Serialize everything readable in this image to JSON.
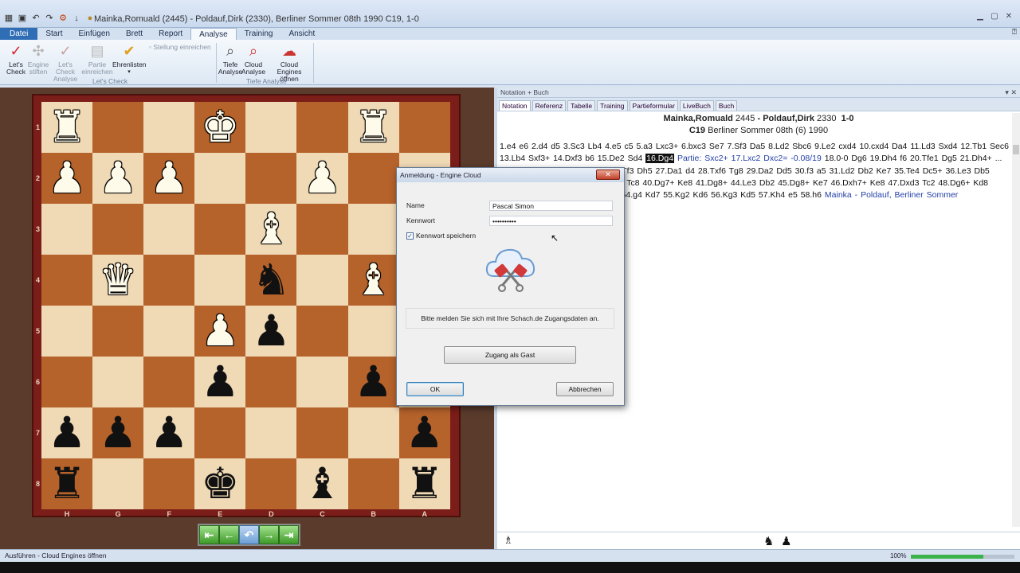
{
  "window": {
    "title": "Mainka,Romuald (2445) - Poldauf,Dirk (2330), Berliner Sommer 08th 1990  C19, 1-0"
  },
  "ribbon": {
    "tabs": [
      "Datei",
      "Start",
      "Einfügen",
      "Brett",
      "Report",
      "Analyse",
      "Training",
      "Ansicht"
    ],
    "active_tab": "Analyse",
    "buttons": {
      "lets_check": "Let's Check",
      "engine_stiften": "Engine stiften",
      "lets_check_analyse": "Let's Check Analyse",
      "partie_einreichen": "Partie einreichen",
      "ehrenlisten": "Ehrenlisten",
      "stellung_einreichen": "Stellung einreichen",
      "tiefe_analyse": "Tiefe Analyse",
      "cloud_analyse": "Cloud Analyse",
      "cloud_engines_oeffnen": "Cloud Engines öffnen"
    },
    "groups": {
      "lets_check": "Let's Check",
      "tiefe_analyse": "Tiefe Analyse"
    }
  },
  "board": {
    "ranks": [
      "1",
      "2",
      "3",
      "4",
      "5",
      "6",
      "7",
      "8"
    ],
    "files": [
      "H",
      "G",
      "F",
      "E",
      "D",
      "C",
      "B",
      "A"
    ],
    "pieces": [
      [
        "♜w",
        "",
        "",
        "♚w",
        "",
        "",
        "♜w",
        ""
      ],
      [
        "♟w",
        "♟w",
        "♟w",
        "",
        "",
        "♟w",
        "",
        ""
      ],
      [
        "",
        "",
        "",
        "",
        "♝w",
        "",
        "",
        ""
      ],
      [
        "",
        "♛w",
        "",
        "",
        "♞b",
        "",
        "♝w",
        ""
      ],
      [
        "",
        "",
        "",
        "♟w",
        "♟b",
        "",
        "",
        ""
      ],
      [
        "",
        "",
        "",
        "♟b",
        "",
        "",
        "♟b",
        ""
      ],
      [
        "♟b",
        "♟b",
        "♟b",
        "",
        "",
        "",
        "",
        "♟b"
      ],
      [
        "♜b",
        "",
        "",
        "♚b",
        "",
        "♝b",
        "",
        "♜b"
      ]
    ]
  },
  "notation": {
    "pane_title": "Notation + Buch",
    "tabs": [
      "Notation",
      "Referenz",
      "Tabelle",
      "Training",
      "Partieformular",
      "LiveBuch",
      "Buch"
    ],
    "active_tab": "Notation",
    "header_line1_white": "Mainka,Romuald",
    "header_line1_white_elo": "2445",
    "header_line1_black": "Poldauf,Dirk",
    "header_line1_black_elo": "2330",
    "header_line1_result": "1-0",
    "header_line2_eco": "C19",
    "header_line2_event": "Berliner Sommer 08th (6) 1990",
    "moves_before": "1.e4  e6  2.d4  d5  3.Sc3  Lb4  4.e5  c5  5.a3  Lxc3+  6.bxc3  Se7  7.Sf3  Da5  8.Ld2  Sbc6  9.Le2  cxd4  10.cxd4  Da4  11.Ld3  Sxd4  12.Tb1  Sec6  13.Lb4  Sxf3+  14.Dxf3  b6  15.De2  Sd4",
    "current_move": "16.Dg4",
    "variation": "Partie: Sxc2+  17.Lxc2  Dxc2=",
    "eval": "-0.08/19",
    "moves_after": "18.0-0  Dg6  19.Dh4  f6  20.Tfe1  Dg5  21.Dh4+ ... Tc4  24.Dd1  gxf6  25.Tg3  Df5  26.Tf3  Dh5  27.Da1  d4  28.Txf6  Tg8  29.Da2  Dd5  30.f3  a5  31.Ld2  Db2  Ke7  35.Te4  Dc5+  36.Le3  Db5  37.Dc1  c3  38.Dxc3  Db1+  39.Lc1  Tc8  40.Dg7+  Ke8  41.Dg8+  44.Le3  Db2  45.Dg8+  Ke7  46.Dxh7+  Ke8  47.Dxd3  Tc2  48.Dg6+  Kd8  49.h4  Kc8  50.h5  Dc3  Lxc1  Le8  54.g4  Kd7  55.Kg2  Kd6  56.Kg3  Kd5  57.Kh4  e5  58.h6",
    "footer_link": "Mainka - Poldauf, Berliner Sommer"
  },
  "dialog": {
    "title": "Anmeldung - Engine Cloud",
    "name_label": "Name",
    "name_value": "Pascal Simon",
    "password_label": "Kennwort",
    "password_value": "••••••••••",
    "remember_label": "Kennwort speichern",
    "remember_checked": true,
    "message": "Bitte melden Sie sich mit Ihre Schach.de Zugangsdaten an.",
    "guest_button": "Zugang als Gast",
    "ok_button": "OK",
    "cancel_button": "Abbrechen"
  },
  "status": {
    "text": "Ausführen - Cloud Engines öffnen",
    "zoom": "100%",
    "zoom_fraction": 0.7
  },
  "colors": {
    "light_square": "#f0d9b5",
    "dark_square": "#b5622b",
    "frame": "#7b1d18",
    "accent": "#2f6db5"
  }
}
